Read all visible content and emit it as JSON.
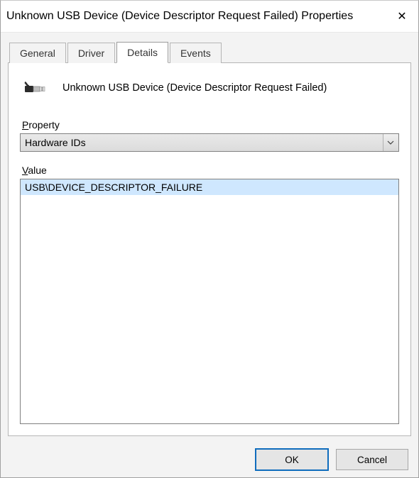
{
  "window": {
    "title": "Unknown USB Device (Device Descriptor Request Failed) Properties"
  },
  "tabs": {
    "general": "General",
    "driver": "Driver",
    "details": "Details",
    "events": "Events",
    "active": "details"
  },
  "details": {
    "device_name": "Unknown USB Device (Device Descriptor Request Failed)",
    "property_label_pre": "P",
    "property_label_rest": "roperty",
    "property_selected": "Hardware IDs",
    "value_label_pre": "V",
    "value_label_rest": "alue",
    "values": [
      "USB\\DEVICE_DESCRIPTOR_FAILURE"
    ]
  },
  "buttons": {
    "ok": "OK",
    "cancel": "Cancel"
  },
  "icons": {
    "close": "✕",
    "chevron_down": "⌄"
  }
}
